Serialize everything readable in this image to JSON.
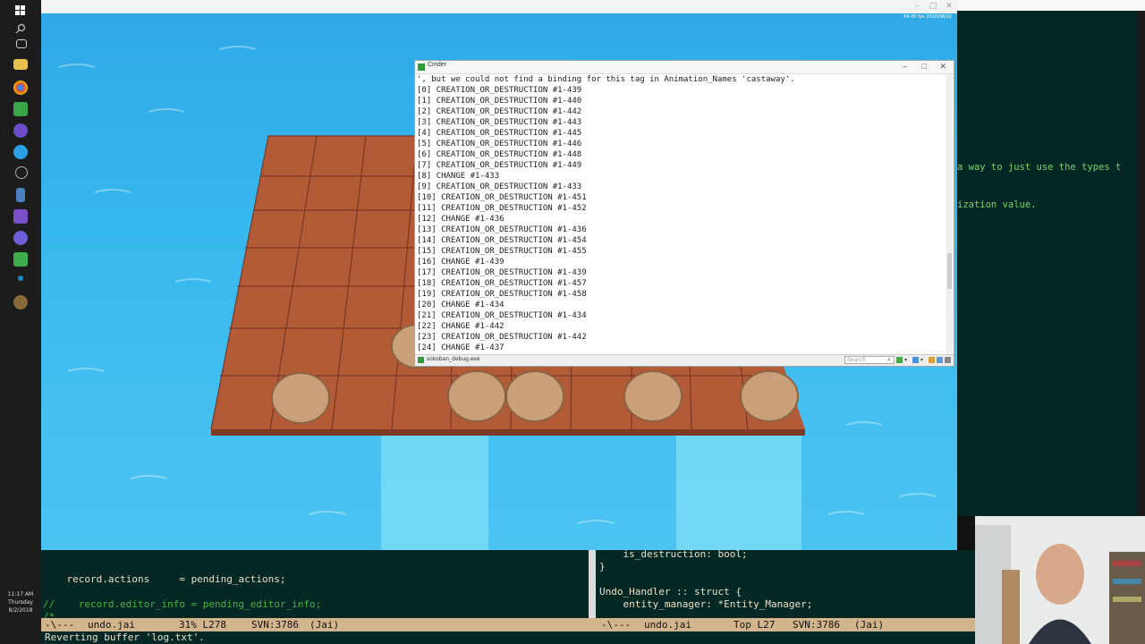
{
  "game_window": {
    "top_right_text": "64.45 fps 2018/08/02"
  },
  "cmd_window": {
    "title": "Cmder",
    "status_tab": "sokoban_debug.exe",
    "search_placeholder": "Search",
    "lines": [
      "', but we could not find a binding for this tag in Animation_Names 'castaway'.",
      "[0] CREATION_OR_DESTRUCTION #1-439",
      "[1] CREATION_OR_DESTRUCTION #1-440",
      "[2] CREATION_OR_DESTRUCTION #1-442",
      "[3] CREATION_OR_DESTRUCTION #1-443",
      "[4] CREATION_OR_DESTRUCTION #1-445",
      "[5] CREATION_OR_DESTRUCTION #1-446",
      "[6] CREATION_OR_DESTRUCTION #1-448",
      "[7] CREATION_OR_DESTRUCTION #1-449",
      "[8] CHANGE #1-433",
      "[9] CREATION_OR_DESTRUCTION #1-433",
      "[10] CREATION_OR_DESTRUCTION #1-451",
      "[11] CREATION_OR_DESTRUCTION #1-452",
      "[12] CHANGE #1-436",
      "[13] CREATION_OR_DESTRUCTION #1-436",
      "[14] CREATION_OR_DESTRUCTION #1-454",
      "[15] CREATION_OR_DESTRUCTION #1-455",
      "[16] CHANGE #1-439",
      "[17] CREATION_OR_DESTRUCTION #1-439",
      "[18] CREATION_OR_DESTRUCTION #1-457",
      "[19] CREATION_OR_DESTRUCTION #1-458",
      "[20] CHANGE #1-434",
      "[21] CREATION_OR_DESTRUCTION #1-434",
      "[22] CHANGE #1-442",
      "[23] CREATION_OR_DESTRUCTION #1-442",
      "[24] CHANGE #1-437"
    ]
  },
  "emacs_right": {
    "lines": [
      "a way to just use the types t",
      "ization value."
    ]
  },
  "pane_left": {
    "line1": "    record.actions     = pending_actions;",
    "line2": "//    record.editor_info = pending_editor_info;",
    "line3": "/*"
  },
  "pane_right": {
    "line1": "    is_destruction: bool;",
    "line2": "}",
    "line3": "Undo_Handler :: struct {",
    "line4": "    entity_manager: *Entity_Manager;"
  },
  "modeline_left": {
    "flags": "-\\---",
    "buffer": "undo.jai",
    "position": "31% L278",
    "svn": "SVN:3786",
    "mode": "(Jai)"
  },
  "modeline_right": {
    "flags": "-\\---",
    "buffer": "undo.jai",
    "position": "Top L27",
    "svn": "SVN:3786",
    "mode": "(Jai)"
  },
  "minibuffer": "Reverting buffer 'log.txt'.",
  "clock": {
    "time": "11:17 AM",
    "day": "Thursday",
    "date": "8/2/2018"
  },
  "colors": {
    "water": "#37b8ee",
    "board": "#b35a37",
    "emacs_bg": "#062825",
    "modeline": "#d3b58d"
  }
}
